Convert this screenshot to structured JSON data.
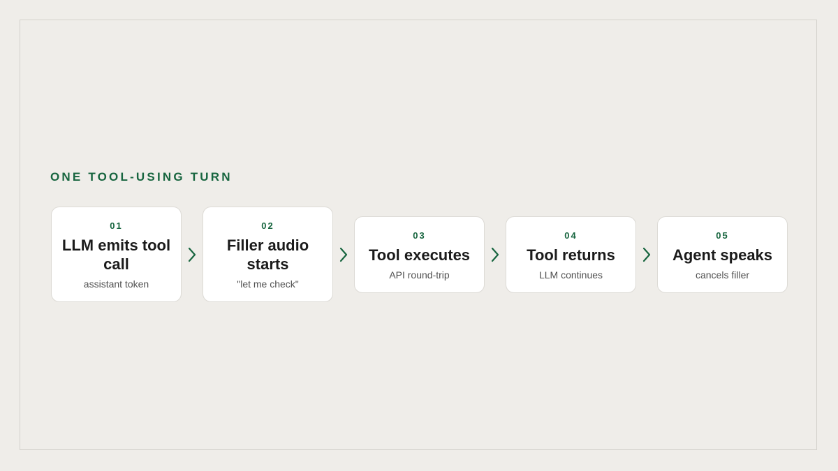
{
  "section_title": "ONE TOOL-USING TURN",
  "accent_color": "#17653f",
  "arrow_icon": "chevron-right-icon",
  "steps": [
    {
      "number": "01",
      "title": "LLM emits tool call",
      "subtitle": "assistant token"
    },
    {
      "number": "02",
      "title": "Filler audio starts",
      "subtitle": "\"let me check\""
    },
    {
      "number": "03",
      "title": "Tool executes",
      "subtitle": "API round-trip"
    },
    {
      "number": "04",
      "title": "Tool returns",
      "subtitle": "LLM continues"
    },
    {
      "number": "05",
      "title": "Agent speaks",
      "subtitle": "cancels filler"
    }
  ]
}
